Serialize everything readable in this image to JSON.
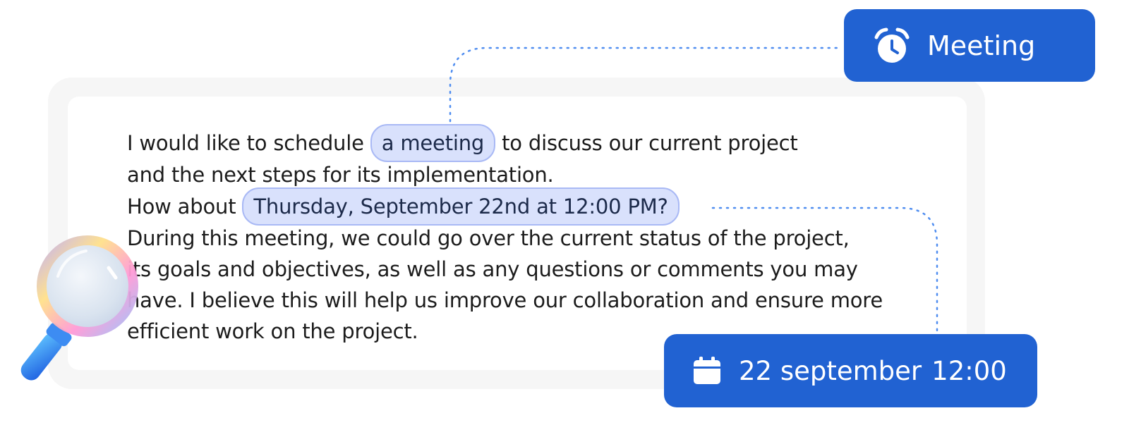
{
  "text_block": {
    "line1_before": "I would like to schedule",
    "highlight_meeting": "a meeting",
    "line1_after": "to discuss our current project",
    "line2": "and the next steps for its implementation.",
    "line3_before": "How about",
    "highlight_datetime": "Thursday, September 22nd at 12:00 PM?",
    "line4": "During this meeting, we could go over the current status of the project,",
    "line5": "its goals and objectives, as well as any questions or comments you may",
    "line6": "have. I believe this will help us improve our collaboration and ensure more",
    "line7": "efficient work on the project."
  },
  "meeting_tag": {
    "label": "Meeting",
    "icon": "alarm-clock-icon"
  },
  "date_tag": {
    "date": "22 september",
    "time": "12:00",
    "icon": "calendar-icon"
  },
  "colors": {
    "accent": "#2162d2",
    "highlight_fill": "#d9e1fc",
    "highlight_border": "#a9b9f5",
    "connector": "#4f8df0"
  }
}
